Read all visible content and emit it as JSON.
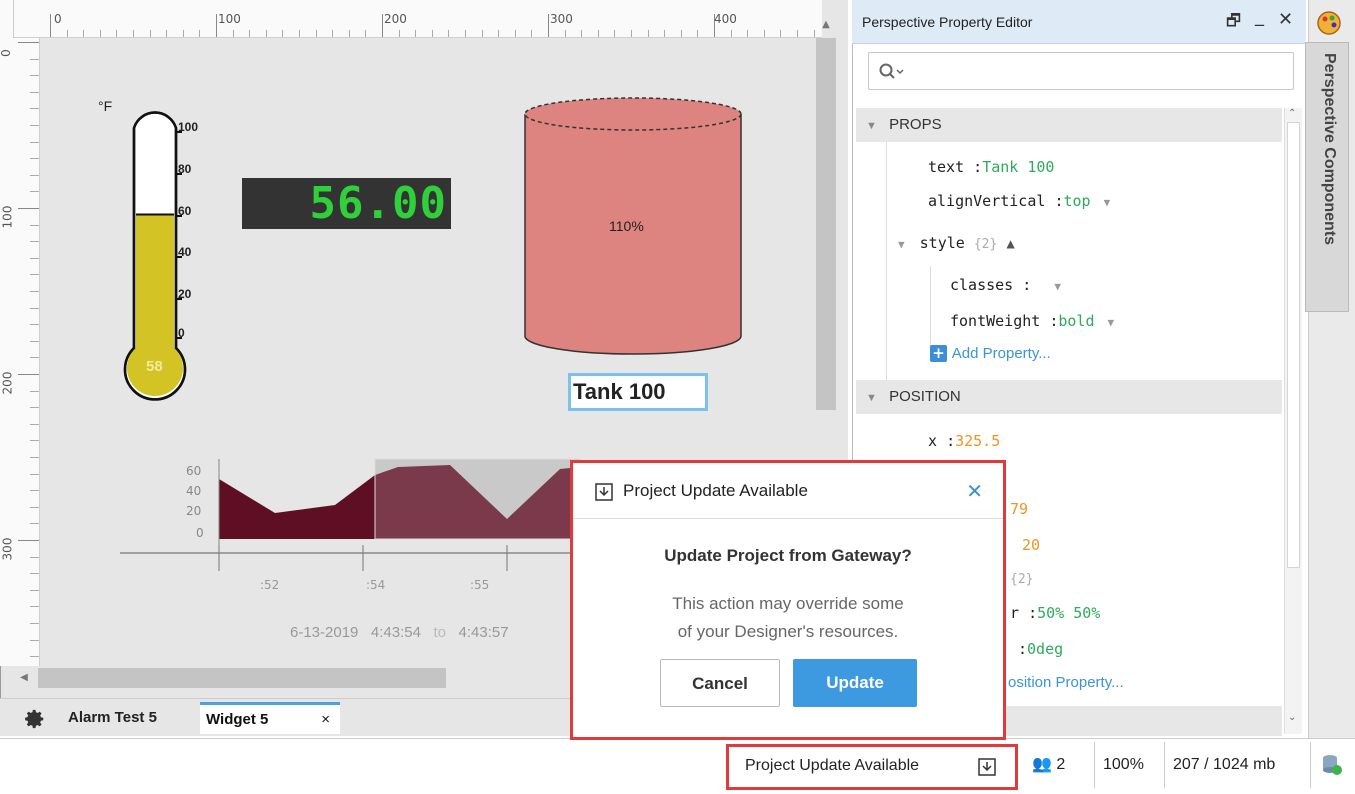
{
  "canvas": {
    "ruler_top": [
      "0",
      "100",
      "200",
      "300",
      "400"
    ],
    "ruler_left": [
      "0",
      "100",
      "200",
      "300"
    ],
    "thermometer": {
      "unit": "°F",
      "ticks": [
        "100",
        "80",
        "60",
        "40",
        "20",
        "0"
      ],
      "value": "58",
      "fill_fraction": 0.58,
      "fill_color": "#d4c325"
    },
    "led_display": {
      "value": "56.00",
      "color": "#2fd13a"
    },
    "tank": {
      "percent_label": "110%",
      "fill_color": "#de8480"
    },
    "tank_label": "Tank 100",
    "sparkline": {
      "y_ticks": [
        "60",
        "40",
        "20",
        "0"
      ],
      "x_ticks": [
        ":52",
        ":54",
        ":55"
      ],
      "date_range": {
        "date": "6-13-2019",
        "start": "4:43:54",
        "to": "to",
        "end": "4:43:57"
      },
      "series_color": "#5f0f24"
    }
  },
  "tabs": {
    "settings_icon": "gear-icon",
    "items": [
      {
        "label": "Alarm Test 5",
        "active": false
      },
      {
        "label": "Widget 5",
        "active": true
      }
    ],
    "close": "×"
  },
  "property_editor": {
    "title": "Perspective Property Editor",
    "window_buttons": {
      "restore": "🗗",
      "minimize": "_",
      "close": "✕"
    },
    "search": {
      "placeholder": ""
    },
    "sections": {
      "props": "PROPS",
      "position": "POSITION"
    },
    "props": {
      "text": {
        "key": "text",
        "sep": ":",
        "value": "Tank 100"
      },
      "alignVertical": {
        "key": "alignVertical",
        "sep": ":",
        "value": "top"
      },
      "style": {
        "key": "style",
        "count": "{2}"
      },
      "classes": {
        "key": "classes",
        "sep": ":"
      },
      "fontWeight": {
        "key": "fontWeight",
        "sep": ":",
        "value": "bold"
      },
      "add": "Add Property..."
    },
    "position": {
      "x": {
        "key": "x",
        "sep": ":",
        "value": "325.5"
      },
      "partial1": "79",
      "partial2": "20",
      "partial3": "{2}",
      "rotation_origin": {
        "key_tail": "r",
        "sep": ":",
        "value": "50% 50%"
      },
      "angle": {
        "sep": ":",
        "value": "0deg"
      },
      "add_partial": "osition Property..."
    },
    "side_tab": "Perspective Components"
  },
  "modal": {
    "title": "Project Update Available",
    "heading": "Update Project from Gateway?",
    "body_line1": "This action may override some",
    "body_line2": "of your Designer's resources.",
    "cancel": "Cancel",
    "update": "Update",
    "close": "✕"
  },
  "status_bar": {
    "update_notice": "Project Update Available",
    "users_count": "2",
    "zoom": "100%",
    "memory": "207 / 1024 mb"
  }
}
